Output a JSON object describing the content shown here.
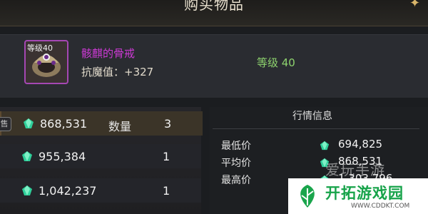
{
  "window": {
    "title": "购买物品"
  },
  "item": {
    "level_badge": "等级40",
    "name": "骸麒的骨戒",
    "stat": "抗魔值：+327",
    "level": "等级 40"
  },
  "listings": {
    "tag": "售",
    "quantity_label": "数量",
    "rows": [
      {
        "price": "868,531",
        "quantity": "3"
      },
      {
        "price": "955,384",
        "quantity": "1"
      },
      {
        "price": "1,042,237",
        "quantity": "1"
      }
    ]
  },
  "market": {
    "title": "行情信息",
    "rows": [
      {
        "label": "最低价",
        "value": "694,825"
      },
      {
        "label": "平均价",
        "value": "868,531"
      },
      {
        "label": "最高价",
        "value": "1,303,796"
      }
    ]
  },
  "watermark": {
    "text": "爱玩手游"
  },
  "brand": {
    "name": "开拓游戏园",
    "url": "WWW.CDDKT.COM"
  },
  "icons": {
    "currency": "green-gem-icon",
    "item": "bone-ring-icon",
    "star": "star-icon",
    "brand": "leaf-logo-icon"
  },
  "colors": {
    "item_name": "#ce3ad6",
    "level": "#8ed36e",
    "currency_gem": "#2fcf9a",
    "item_border": "#a547b3"
  }
}
